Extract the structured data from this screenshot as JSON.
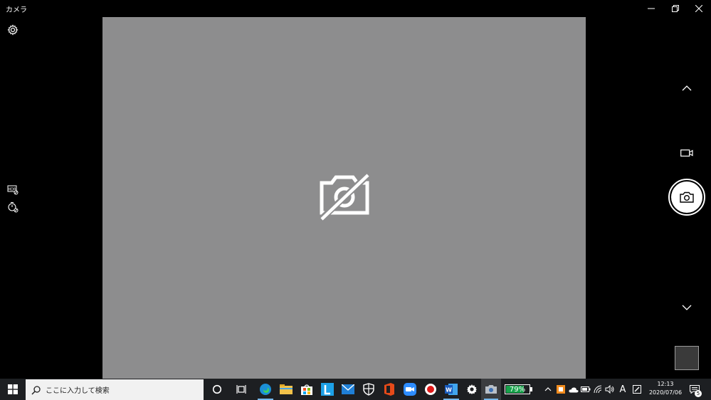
{
  "window": {
    "title": "カメラ"
  },
  "taskbar": {
    "search_placeholder": "ここに入力して検索",
    "battery_percent": "79%",
    "battery_level": 0.79,
    "ime_label": "A",
    "clock_time": "12:13",
    "clock_date": "2020/07/06",
    "notification_count": "5"
  },
  "colors": {
    "preview_bg": "#8d8d8e",
    "taskbar_bg": "#1d1f22",
    "battery_green": "#16a34a"
  }
}
